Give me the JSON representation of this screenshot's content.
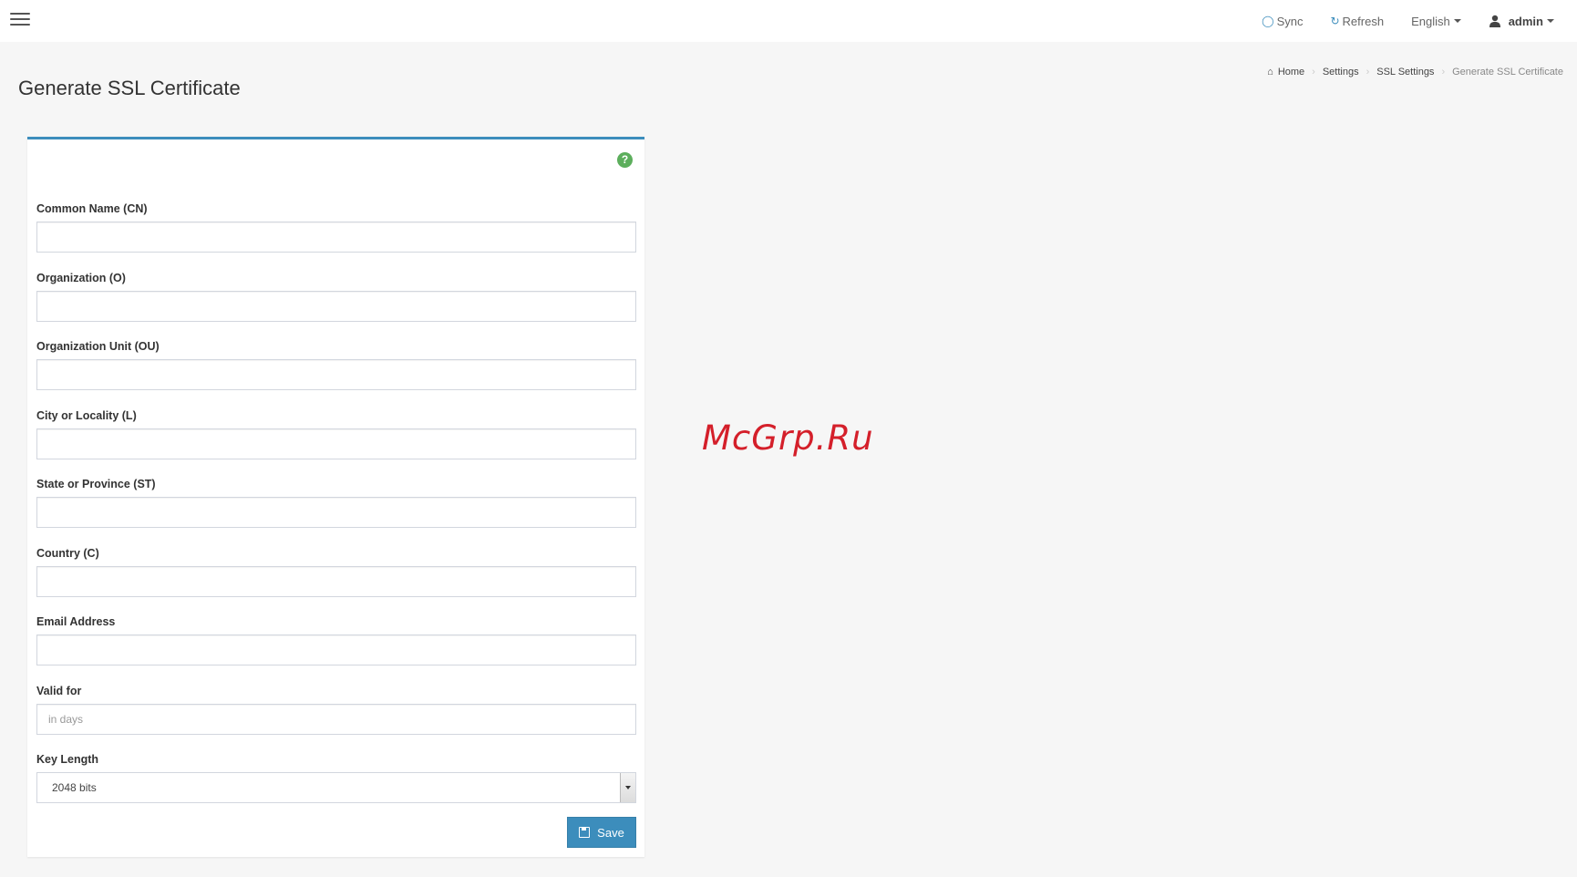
{
  "topbar": {
    "menu_icon": "hamburger-menu-icon",
    "sync_label": "Sync",
    "refresh_label": "Refresh",
    "language_label": "English",
    "user_label": "admin"
  },
  "page": {
    "title": "Generate SSL Certificate"
  },
  "breadcrumb": {
    "home": "Home",
    "settings": "Settings",
    "ssl_settings": "SSL Settings",
    "current": "Generate SSL Certificate"
  },
  "form": {
    "fields": [
      {
        "label": "Common Name (CN)",
        "value": "",
        "placeholder": ""
      },
      {
        "label": "Organization (O)",
        "value": "",
        "placeholder": ""
      },
      {
        "label": "Organization Unit (OU)",
        "value": "",
        "placeholder": ""
      },
      {
        "label": "City or Locality (L)",
        "value": "",
        "placeholder": ""
      },
      {
        "label": "State or Province (ST)",
        "value": "",
        "placeholder": ""
      },
      {
        "label": "Country (C)",
        "value": "",
        "placeholder": ""
      },
      {
        "label": "Email Address",
        "value": "",
        "placeholder": ""
      },
      {
        "label": "Valid for",
        "value": "",
        "placeholder": "in days"
      }
    ],
    "key_length": {
      "label": "Key Length",
      "selected": "2048 bits"
    },
    "save_label": "Save"
  },
  "watermark": "McGrp.Ru",
  "colors": {
    "accent": "#3c8dbc",
    "help": "#5cae5c",
    "watermark": "#d41f2a"
  }
}
